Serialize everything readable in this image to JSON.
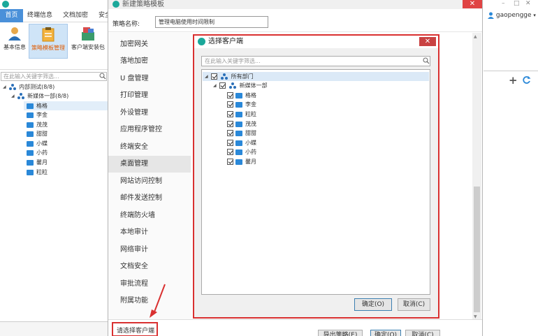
{
  "app": {
    "tabs": [
      "首页",
      "终端信息",
      "文档加密",
      "安全"
    ],
    "ribbon": [
      "基本信息",
      "策略模板管理",
      "客户端安装包"
    ],
    "search_placeholder": "在此输入关键字筛选...",
    "tree": {
      "root": "内部测试(8/8)",
      "group": "新媒体一部(8/8)",
      "clients": [
        "格格",
        "李金",
        "茂茂",
        "甜甜",
        "小蝶",
        "小药",
        "馨月",
        "粒粒"
      ]
    }
  },
  "policy_dialog": {
    "title": "新建策略模板",
    "name_label": "策略名称:",
    "name_value": "管理电脑使用时间限制",
    "nav": [
      "加密网关",
      "落地加密",
      "U 盘管理",
      "打印管理",
      "外设管理",
      "应用程序管控",
      "终端安全",
      "桌面管理",
      "网站访问控制",
      "邮件发送控制",
      "终端防火墙",
      "本地审计",
      "网络审计",
      "文档安全",
      "审批流程",
      "附属功能"
    ],
    "select_client_label": "请选择客户端",
    "buttons": {
      "export": "导出策略(E)",
      "ok": "确定(O)",
      "cancel": "取消(C)"
    }
  },
  "client_dialog": {
    "title": "选择客户端",
    "search_placeholder": "在此输入关键字筛选...",
    "tree": {
      "root": "所有部门",
      "group": "新媒体一部",
      "clients": [
        "格格",
        "李金",
        "粒粒",
        "茂茂",
        "甜甜",
        "小蝶",
        "小药",
        "馨月"
      ]
    },
    "buttons": {
      "ok": "确定(O)",
      "cancel": "取消(C)"
    }
  },
  "user_panel": {
    "username": "gaopengge"
  },
  "colors": {
    "accent": "#4a90d9",
    "highlight_red": "#d93030",
    "brand_teal": "#1aa89a",
    "pc_blue": "#2a88d8"
  }
}
